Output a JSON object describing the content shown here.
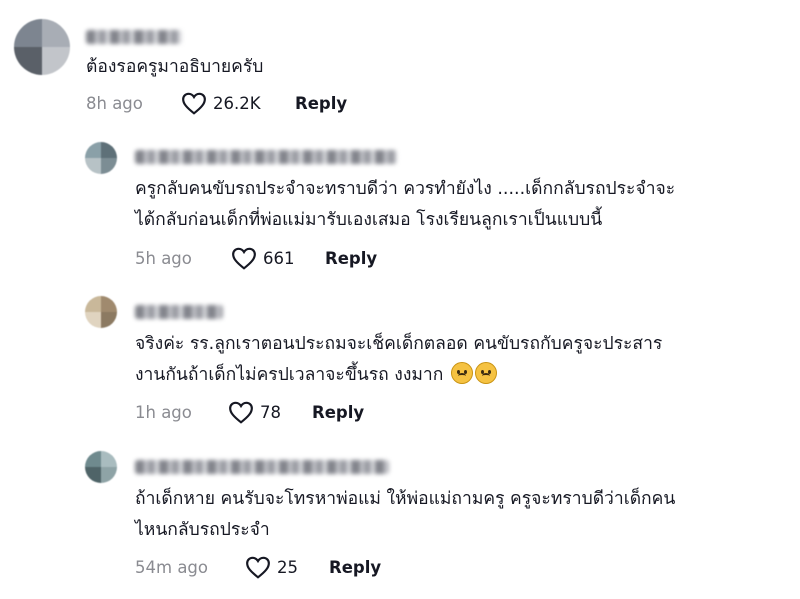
{
  "comments": [
    {
      "text_lines": [
        "ต้องรอครูมาอธิบายครับ"
      ],
      "time": "8h ago",
      "likes": "26.2K",
      "reply": "Reply",
      "avatar_colors": [
        "#7d8590",
        "#a8adb5",
        "#5a6068",
        "#c2c5ca"
      ]
    },
    {
      "text_lines": [
        "ครูกลับคนขับรถประจำจะทราบดีว่า ควรทำยังไง .....เด็กกลับรถประจำจะ",
        "ได้กลับก่อนเด็กที่พ่อแม่มารับเองเสมอ โรงเรียนลูกเราเป็นแบบนี้"
      ],
      "time": "5h ago",
      "likes": "661",
      "reply": "Reply",
      "avatar_colors": [
        "#8aa0a8",
        "#5e7078",
        "#b7c2c6",
        "#7c8d94"
      ]
    },
    {
      "text_lines": [
        "จริงค่ะ รร.ลูกเราตอนประถมจะเช็คเด็กตลอด คนขับรถกับครูจะประสาร",
        "งานกันถ้าเด็กไม่ครปเวลาจะขึ้นรถ งงมาก"
      ],
      "time": "1h ago",
      "likes": "78",
      "reply": "Reply",
      "emojis": [
        "sad-face-emoji",
        "sad-face-emoji"
      ],
      "avatar_colors": [
        "#c9b89a",
        "#a08a6e",
        "#e0d4c0",
        "#8c7a62"
      ]
    },
    {
      "text_lines": [
        "ถ้าเด็กหาย คนรับจะโทรหาพ่อแม่ ให้พ่อแม่ถามครู ครูจะทราบดีว่าเด็กคน",
        "ไหนกลับรถประจำ"
      ],
      "time": "54m ago",
      "likes": "25",
      "reply": "Reply",
      "avatar_colors": [
        "#6f8a8e",
        "#a9bcbf",
        "#4f6468",
        "#8ea3a6"
      ]
    }
  ]
}
